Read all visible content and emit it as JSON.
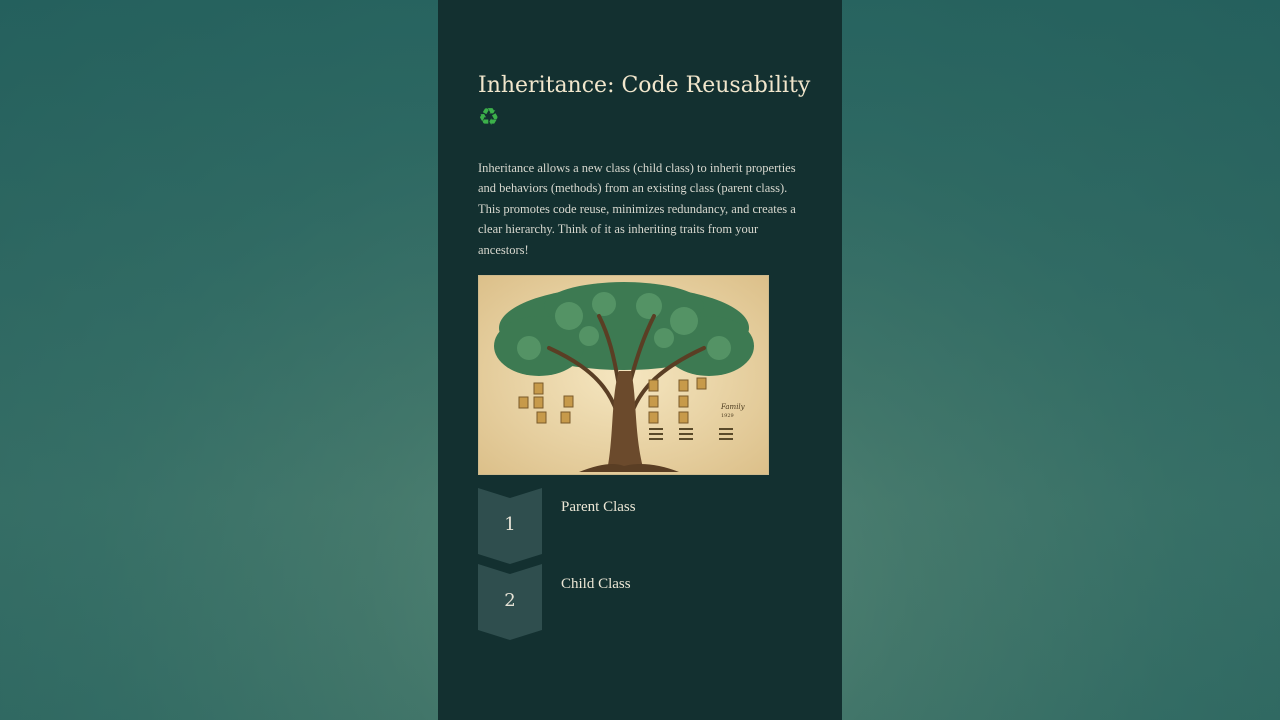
{
  "slide": {
    "title": "Inheritance: Code Reusability",
    "title_icon": "recycle-icon",
    "title_icon_glyph": "♻",
    "body": "Inheritance allows a new class (child class) to inherit properties and behaviors (methods) from an existing class (parent class). This promotes code reuse, minimizes redundancy, and creates a clear hierarchy. Think of it as inheriting traits from your ancestors!",
    "image": {
      "subject": "family-tree-illustration",
      "caption": "Family",
      "caption_sub": "1929"
    },
    "steps": [
      {
        "number": "1",
        "label": "Parent Class"
      },
      {
        "number": "2",
        "label": "Child Class"
      }
    ]
  },
  "colors": {
    "slide_bg": "#133030",
    "title": "#f1e6cc",
    "step_badge": "#2f4e4e",
    "accent_green": "#3cb04a"
  }
}
